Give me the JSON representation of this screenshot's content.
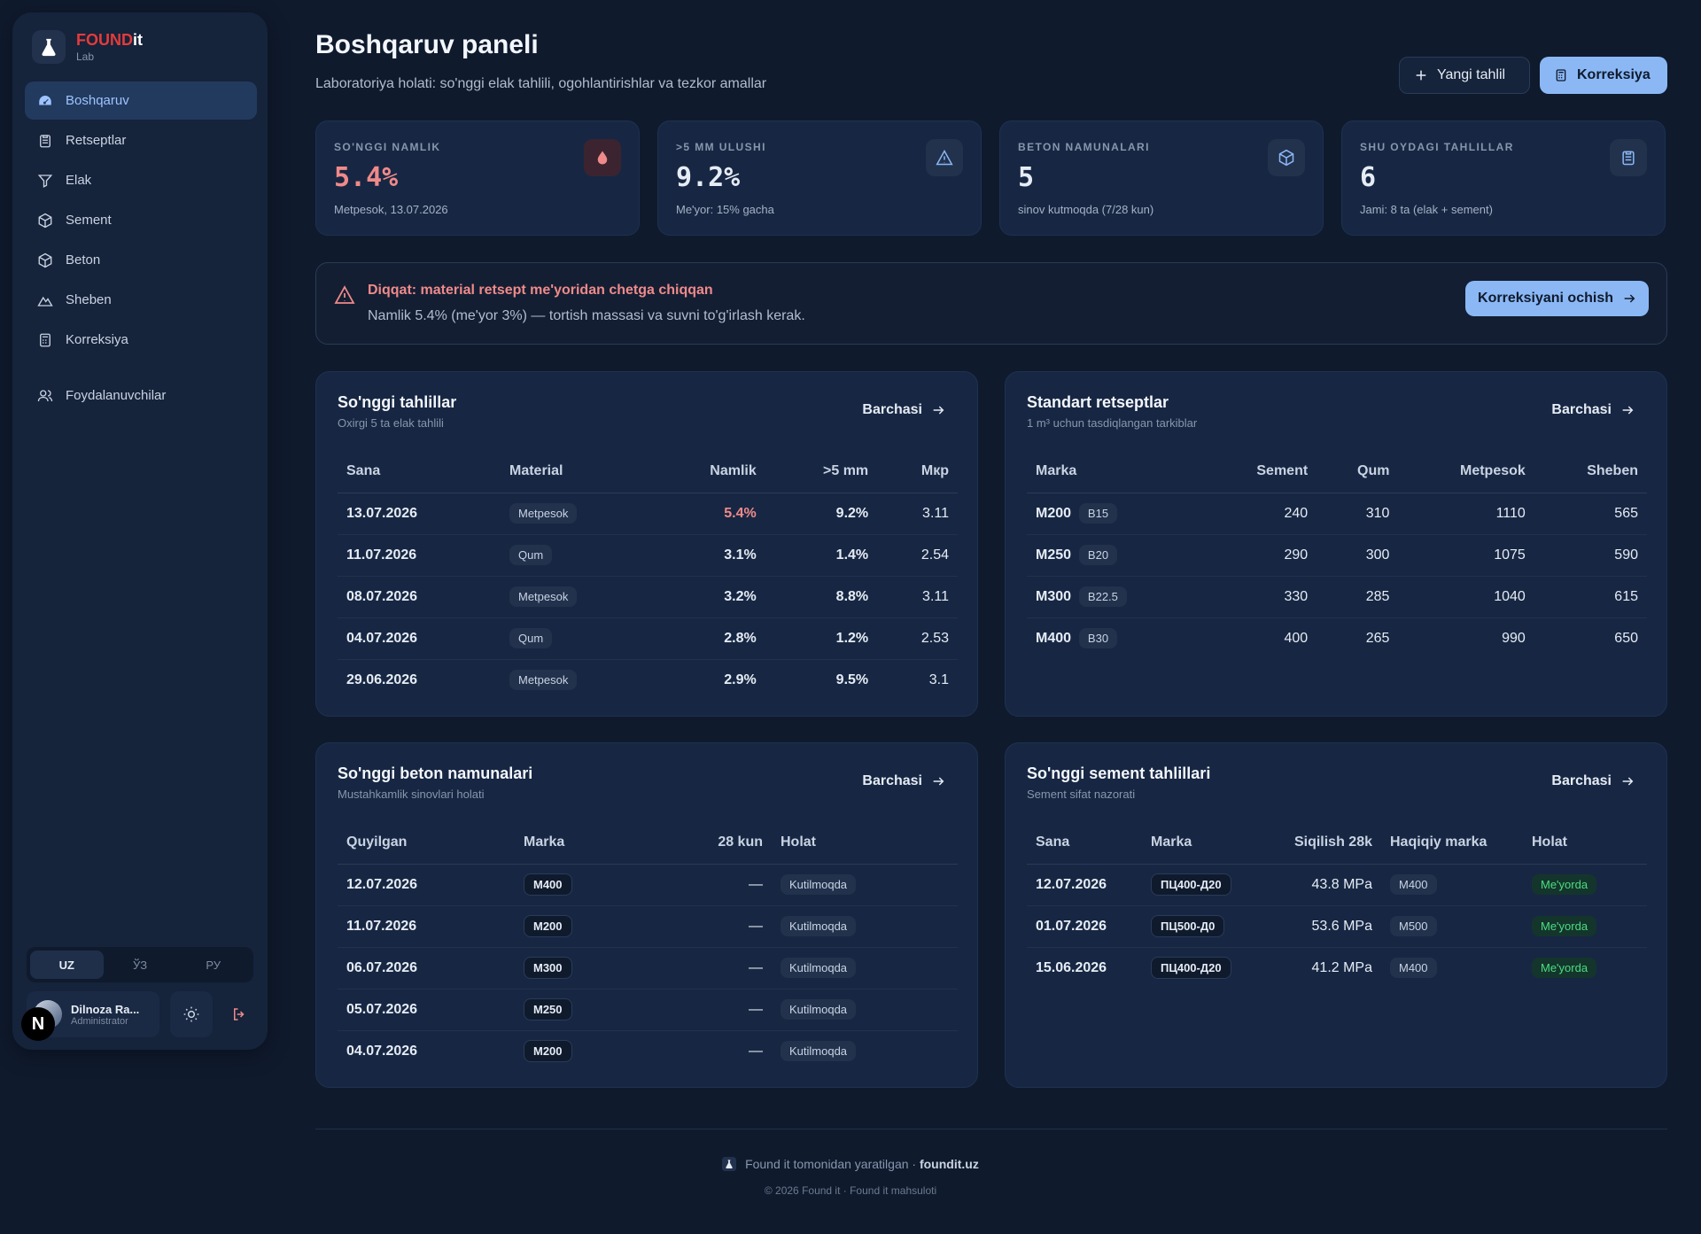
{
  "brand": {
    "name_red": "FOUND",
    "name_white": "it",
    "sub": "Lab"
  },
  "sidebar": {
    "items": [
      {
        "label": "Boshqaruv"
      },
      {
        "label": "Retseptlar"
      },
      {
        "label": "Elak"
      },
      {
        "label": "Sement"
      },
      {
        "label": "Beton"
      },
      {
        "label": "Sheben"
      },
      {
        "label": "Korreksiya"
      },
      {
        "label": "Foydalanuvchilar"
      }
    ],
    "languages": [
      "UZ",
      "ЎЗ",
      "РУ"
    ],
    "user": {
      "initial": "N",
      "name": "Dilnoza Ra...",
      "role": "Administrator"
    }
  },
  "header": {
    "title": "Boshqaruv paneli",
    "subtitle": "Laboratoriya holati: so'nggi elak tahlili, ogohlantirishlar va tezkor amallar",
    "new_label": "Yangi tahlil",
    "korr_label": "Korreksiya"
  },
  "stats": [
    {
      "label": "SO'NGGI NAMLIK",
      "value": "5.4%",
      "note": "Metpesok, 13.07.2026"
    },
    {
      "label": ">5 MM ULUSHI",
      "value": "9.2%",
      "note": "Me'yor: 15% gacha"
    },
    {
      "label": "BETON NAMUNALARI",
      "value": "5",
      "note": "sinov kutmoqda (7/28 kun)"
    },
    {
      "label": "SHU OYDAGI TAHLILLAR",
      "value": "6",
      "note": "Jami: 8 ta (elak + sement)"
    }
  ],
  "colors": {
    "accent": "#8bb8f5",
    "danger": "#f08a8a",
    "ok": "#4ade80"
  },
  "alert": {
    "title": "Diqqat: material retsept me'yoridan chetga chiqqan",
    "text": "Namlik 5.4% (me'yor 3%) — tortish massasi va suvni to'g'irlash kerak.",
    "button": "Korreksiyani ochish"
  },
  "analyses": {
    "title": "So'nggi tahlillar",
    "subtitle": "Oxirgi 5 ta elak tahlili",
    "link": "Barchasi",
    "headers": [
      "Sana",
      "Material",
      "Namlik",
      ">5 mm",
      "Мкр"
    ],
    "rows": [
      [
        "13.07.2026",
        "Metpesok",
        "5.4%",
        "9.2%",
        "3.11"
      ],
      [
        "11.07.2026",
        "Qum",
        "3.1%",
        "1.4%",
        "2.54"
      ],
      [
        "08.07.2026",
        "Metpesok",
        "3.2%",
        "8.8%",
        "3.11"
      ],
      [
        "04.07.2026",
        "Qum",
        "2.8%",
        "1.2%",
        "2.53"
      ],
      [
        "29.06.2026",
        "Metpesok",
        "2.9%",
        "9.5%",
        "3.1"
      ]
    ]
  },
  "recipes": {
    "title": "Standart retseptlar",
    "subtitle": "1 m³ uchun tasdiqlangan tarkiblar",
    "link": "Barchasi",
    "headers": [
      "Marka",
      "Sement",
      "Qum",
      "Metpesok",
      "Sheben"
    ],
    "rows": [
      [
        "M200",
        "B15",
        "240",
        "310",
        "1110",
        "565"
      ],
      [
        "M250",
        "B20",
        "290",
        "300",
        "1075",
        "590"
      ],
      [
        "M300",
        "B22.5",
        "330",
        "285",
        "1040",
        "615"
      ],
      [
        "M400",
        "B30",
        "400",
        "265",
        "990",
        "650"
      ]
    ]
  },
  "concrete": {
    "title": "So'nggi beton namunalari",
    "subtitle": "Mustahkamlik sinovlari holati",
    "link": "Barchasi",
    "headers": [
      "Quyilgan",
      "Marka",
      "28 kun",
      "Holat"
    ],
    "rows": [
      [
        "12.07.2026",
        "M400",
        "—",
        "Kutilmoqda"
      ],
      [
        "11.07.2026",
        "M200",
        "—",
        "Kutilmoqda"
      ],
      [
        "06.07.2026",
        "M300",
        "—",
        "Kutilmoqda"
      ],
      [
        "05.07.2026",
        "M250",
        "—",
        "Kutilmoqda"
      ],
      [
        "04.07.2026",
        "M200",
        "—",
        "Kutilmoqda"
      ]
    ]
  },
  "cement": {
    "title": "So'nggi sement tahlillari",
    "subtitle": "Sement sifat nazorati",
    "link": "Barchasi",
    "headers": [
      "Sana",
      "Marka",
      "Siqilish 28k",
      "Haqiqiy marka",
      "Holat"
    ],
    "rows": [
      [
        "12.07.2026",
        "ПЦ400-Д20",
        "43.8 MPa",
        "M400",
        "Me'yorda"
      ],
      [
        "01.07.2026",
        "ПЦ500-Д0",
        "53.6 MPa",
        "M500",
        "Me'yorda"
      ],
      [
        "15.06.2026",
        "ПЦ400-Д20",
        "41.2 MPa",
        "M400",
        "Me'yorda"
      ]
    ]
  },
  "footer": {
    "text": "Found it tomonidan yaratilgan · ",
    "site": "foundit.uz",
    "copy": "© 2026 Found it · Found it mahsuloti"
  }
}
